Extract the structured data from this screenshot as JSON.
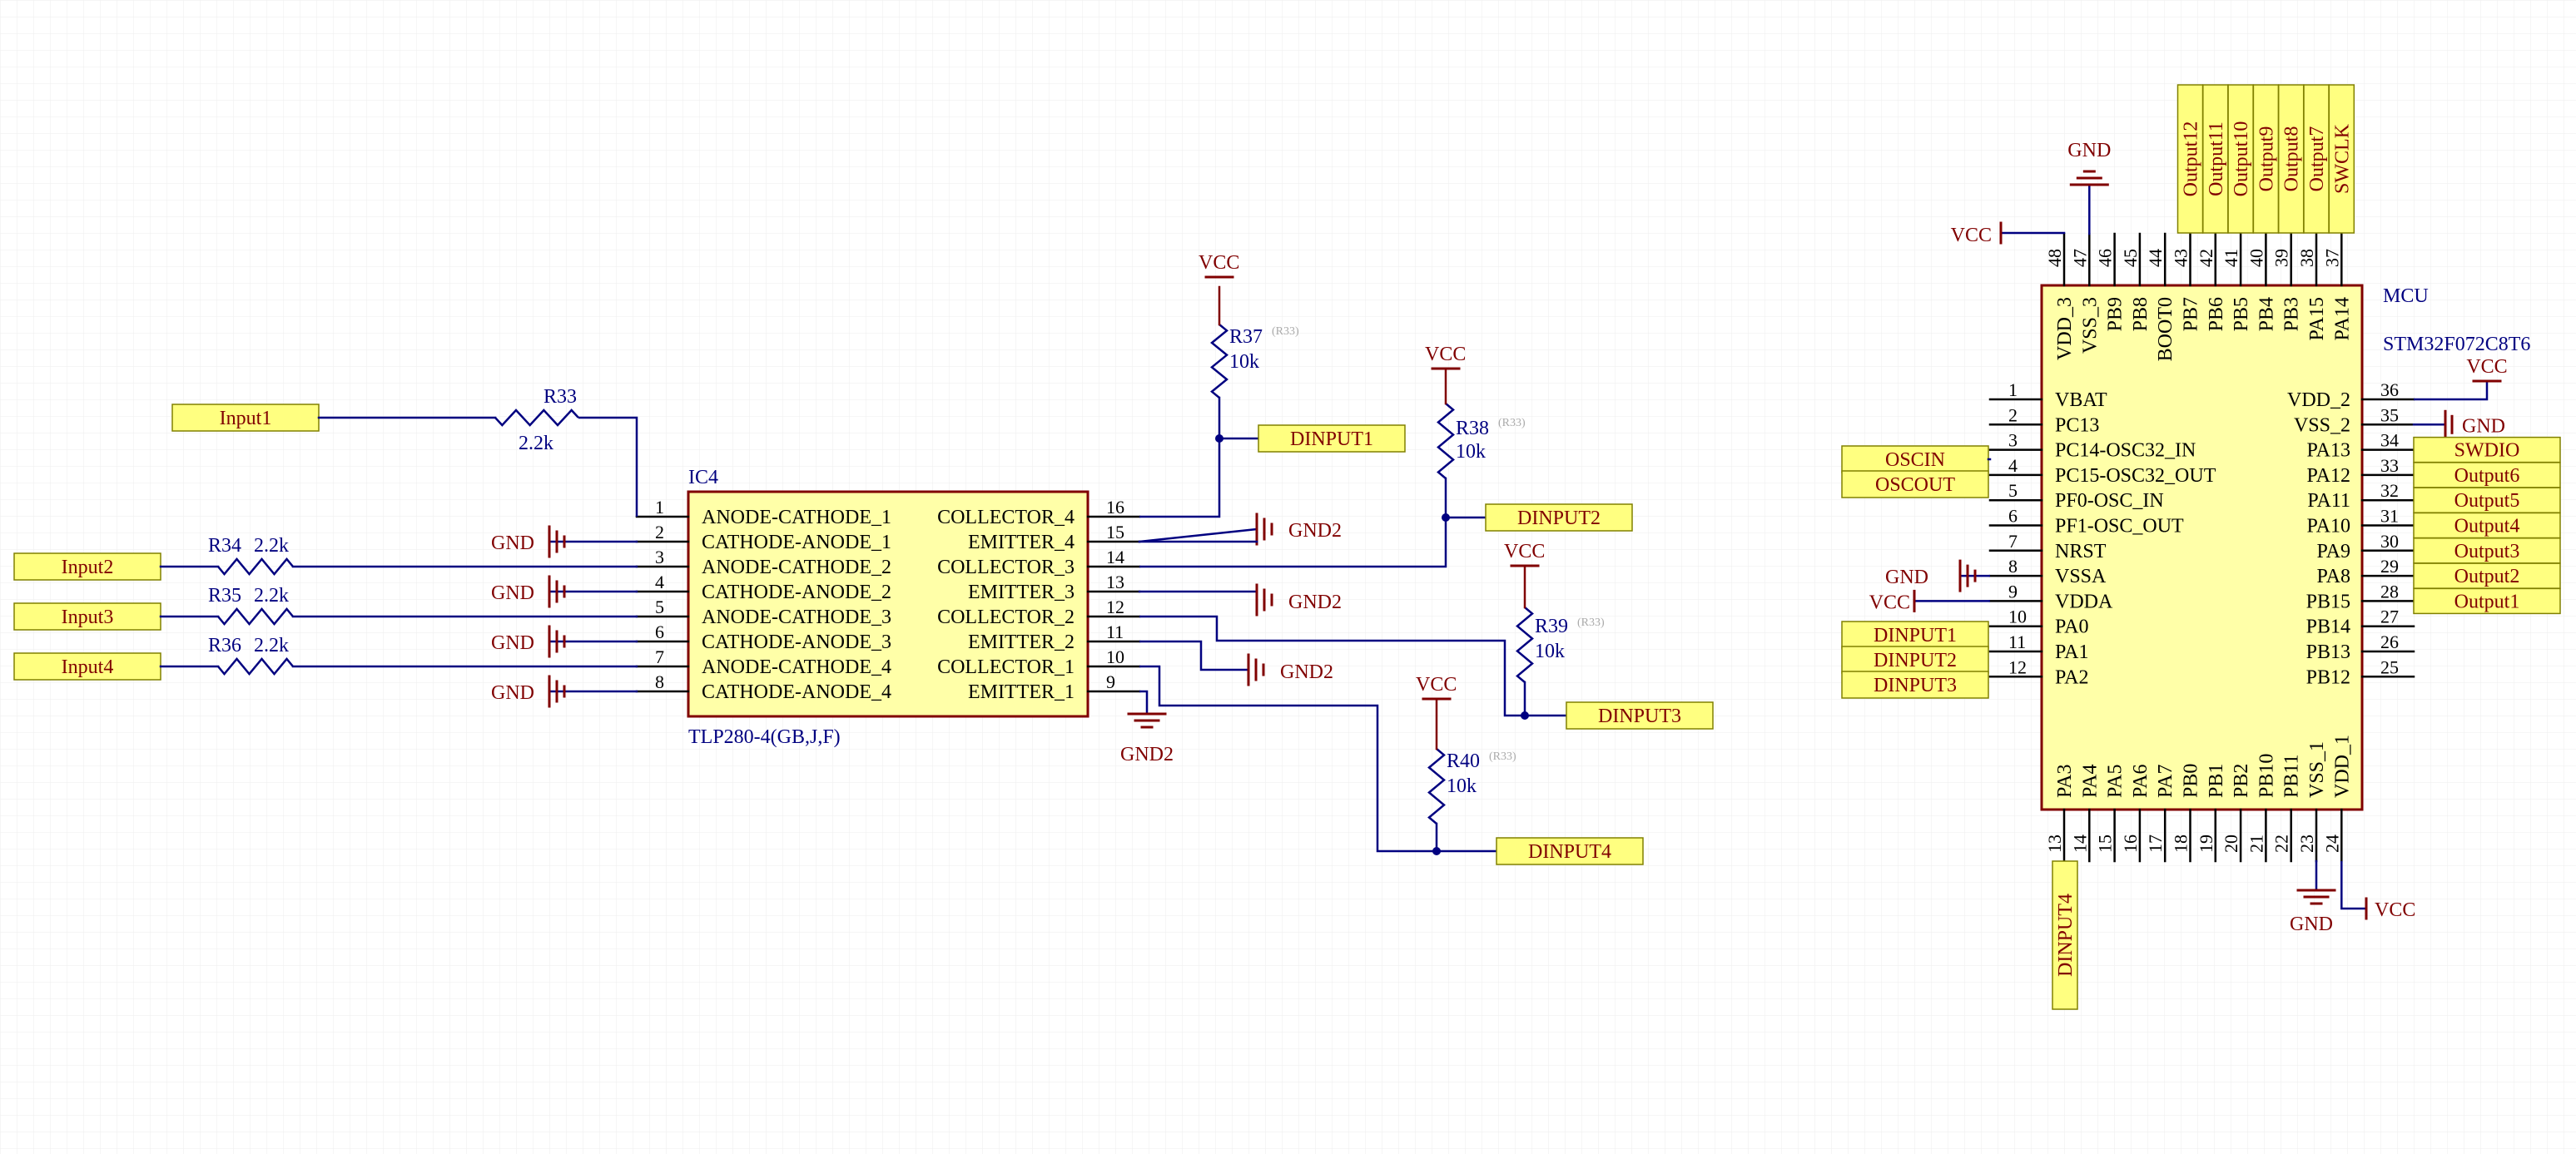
{
  "colors": {
    "background": "#ffffff",
    "grid": "#eeeeee",
    "wire": "#000080",
    "power": "#800000",
    "body_fill": "#ffffa8",
    "body_stroke": "#800000",
    "net_fill": "#ffff80",
    "net_stroke": "#808000",
    "comp_text": "#000080",
    "pin_text": "#000000",
    "gray": "#aaaaaa"
  },
  "ic4": {
    "designator": "IC4",
    "part": "TLP280-4(GB,J,F)",
    "left_pins": [
      {
        "num": "1",
        "name": "ANODE-CATHODE_1"
      },
      {
        "num": "2",
        "name": "CATHODE-ANODE_1"
      },
      {
        "num": "3",
        "name": "ANODE-CATHODE_2"
      },
      {
        "num": "4",
        "name": "CATHODE-ANODE_2"
      },
      {
        "num": "5",
        "name": "ANODE-CATHODE_3"
      },
      {
        "num": "6",
        "name": "CATHODE-ANODE_3"
      },
      {
        "num": "7",
        "name": "ANODE-CATHODE_4"
      },
      {
        "num": "8",
        "name": "CATHODE-ANODE_4"
      }
    ],
    "right_pins": [
      {
        "num": "16",
        "name": "COLLECTOR_4"
      },
      {
        "num": "15",
        "name": "EMITTER_4"
      },
      {
        "num": "14",
        "name": "COLLECTOR_3"
      },
      {
        "num": "13",
        "name": "EMITTER_3"
      },
      {
        "num": "12",
        "name": "COLLECTOR_2"
      },
      {
        "num": "11",
        "name": "EMITTER_2"
      },
      {
        "num": "10",
        "name": "COLLECTOR_1"
      },
      {
        "num": "9",
        "name": "EMITTER_1"
      }
    ]
  },
  "resistors": [
    {
      "id": "R33",
      "value": "2.2k"
    },
    {
      "id": "R34",
      "value": "2.2k"
    },
    {
      "id": "R35",
      "value": "2.2k"
    },
    {
      "id": "R36",
      "value": "2.2k"
    },
    {
      "id": "R37",
      "value": "10k",
      "ref": "(R33)"
    },
    {
      "id": "R38",
      "value": "10k",
      "ref": "(R33)"
    },
    {
      "id": "R39",
      "value": "10k",
      "ref": "(R33)"
    },
    {
      "id": "R40",
      "value": "10k",
      "ref": "(R33)"
    }
  ],
  "nets": {
    "input1": "Input1",
    "input2": "Input2",
    "input3": "Input3",
    "input4": "Input4",
    "dinput1": "DINPUT1",
    "dinput2": "DINPUT2",
    "dinput3": "DINPUT3",
    "dinput4": "DINPUT4",
    "oscin": "OSCIN",
    "oscout": "OSCOUT",
    "swdio": "SWDIO",
    "swclk": "SWCLK",
    "out1": "Output1",
    "out2": "Output2",
    "out3": "Output3",
    "out4": "Output4",
    "out5": "Output5",
    "out6": "Output6",
    "out7": "Output7",
    "out8": "Output8",
    "out9": "Output9",
    "out10": "Output10",
    "out11": "Output11",
    "out12": "Output12"
  },
  "power": {
    "vcc": "VCC",
    "gnd": "GND",
    "gnd2": "GND2"
  },
  "mcu": {
    "designator": "MCU",
    "part": "STM32F072C8T6",
    "left_pins": [
      {
        "num": "1",
        "name": "VBAT"
      },
      {
        "num": "2",
        "name": "PC13"
      },
      {
        "num": "3",
        "name": "PC14-OSC32_IN"
      },
      {
        "num": "4",
        "name": "PC15-OSC32_OUT"
      },
      {
        "num": "5",
        "name": "PF0-OSC_IN"
      },
      {
        "num": "6",
        "name": "PF1-OSC_OUT"
      },
      {
        "num": "7",
        "name": "NRST"
      },
      {
        "num": "8",
        "name": "VSSA"
      },
      {
        "num": "9",
        "name": "VDDA"
      },
      {
        "num": "10",
        "name": "PA0"
      },
      {
        "num": "11",
        "name": "PA1"
      },
      {
        "num": "12",
        "name": "PA2"
      }
    ],
    "right_pins": [
      {
        "num": "36",
        "name": "VDD_2"
      },
      {
        "num": "35",
        "name": "VSS_2"
      },
      {
        "num": "34",
        "name": "PA13"
      },
      {
        "num": "33",
        "name": "PA12"
      },
      {
        "num": "32",
        "name": "PA11"
      },
      {
        "num": "31",
        "name": "PA10"
      },
      {
        "num": "30",
        "name": "PA9"
      },
      {
        "num": "29",
        "name": "PA8"
      },
      {
        "num": "28",
        "name": "PB15"
      },
      {
        "num": "27",
        "name": "PB14"
      },
      {
        "num": "26",
        "name": "PB13"
      },
      {
        "num": "25",
        "name": "PB12"
      }
    ],
    "top_pins": [
      {
        "num": "48",
        "name": "VDD_3"
      },
      {
        "num": "47",
        "name": "VSS_3"
      },
      {
        "num": "46",
        "name": "PB9"
      },
      {
        "num": "45",
        "name": "PB8"
      },
      {
        "num": "44",
        "name": "BOOT0"
      },
      {
        "num": "43",
        "name": "PB7"
      },
      {
        "num": "42",
        "name": "PB6"
      },
      {
        "num": "41",
        "name": "PB5"
      },
      {
        "num": "40",
        "name": "PB4"
      },
      {
        "num": "39",
        "name": "PB3"
      },
      {
        "num": "38",
        "name": "PA15"
      },
      {
        "num": "37",
        "name": "PA14"
      }
    ],
    "bottom_pins": [
      {
        "num": "13",
        "name": "PA3"
      },
      {
        "num": "14",
        "name": "PA4"
      },
      {
        "num": "15",
        "name": "PA5"
      },
      {
        "num": "16",
        "name": "PA6"
      },
      {
        "num": "17",
        "name": "PA7"
      },
      {
        "num": "18",
        "name": "PB0"
      },
      {
        "num": "19",
        "name": "PB1"
      },
      {
        "num": "20",
        "name": "PB2"
      },
      {
        "num": "21",
        "name": "PB10"
      },
      {
        "num": "22",
        "name": "PB11"
      },
      {
        "num": "23",
        "name": "VSS_1"
      },
      {
        "num": "24",
        "name": "VDD_1"
      }
    ]
  }
}
